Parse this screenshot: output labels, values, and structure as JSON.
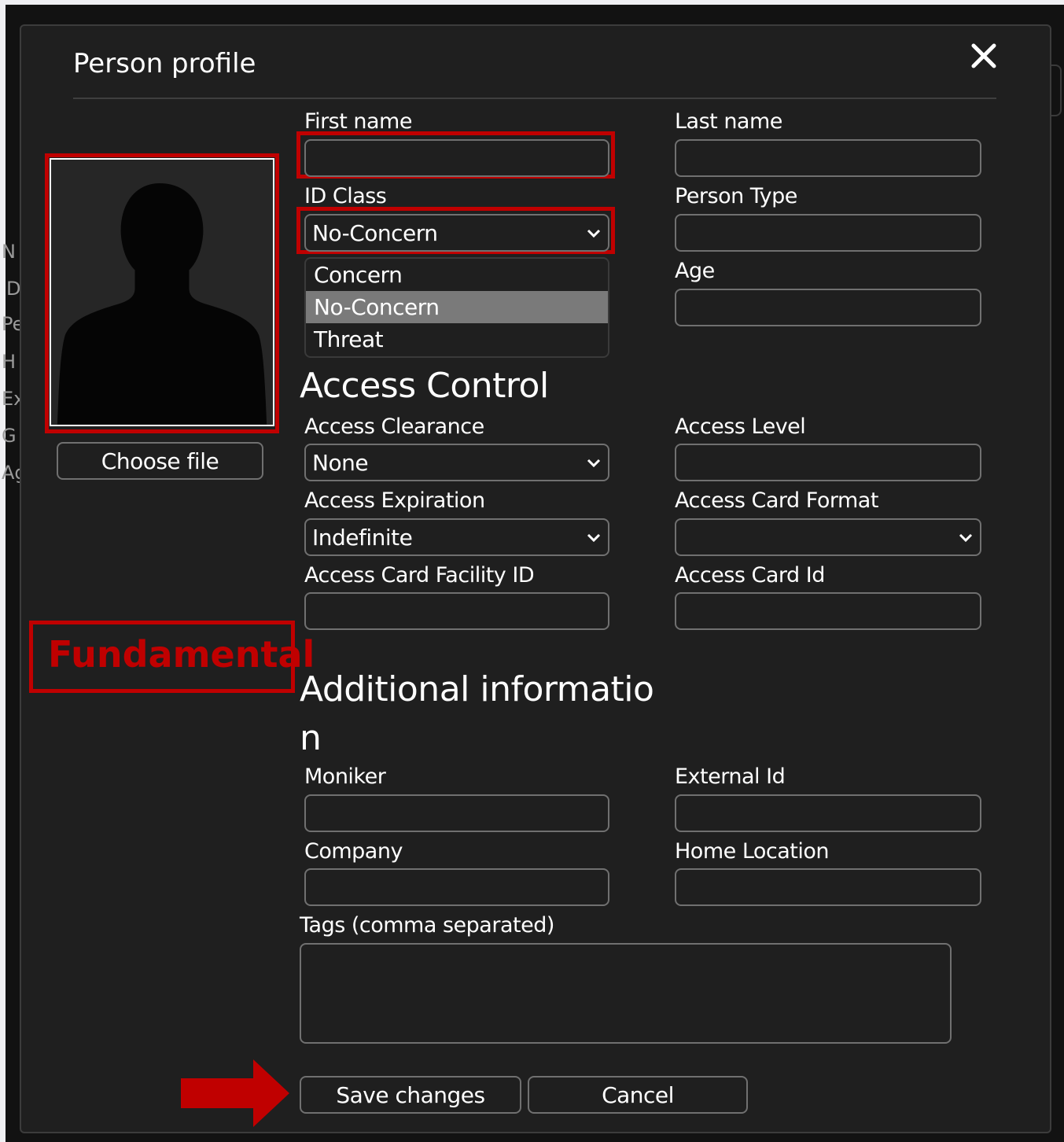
{
  "background": {
    "clipped_labels": [
      "N",
      "D",
      "Pe",
      "H",
      "Ex",
      "G",
      "Ag"
    ]
  },
  "modal": {
    "title": "Person profile",
    "close_icon": "close-icon"
  },
  "photo": {
    "placeholder_icon": "person-silhouette-icon",
    "choose_file_label": "Choose file"
  },
  "annotations": {
    "fundamental_label": "Fundamental",
    "highlight_color": "#c00000",
    "arrow_icon": "arrow-right-icon"
  },
  "fundamental": {
    "first_name": {
      "label": "First name",
      "value": ""
    },
    "last_name": {
      "label": "Last name",
      "value": ""
    },
    "id_class": {
      "label": "ID Class",
      "selected": "No-Concern",
      "options": [
        "Concern",
        "No-Concern",
        "Threat"
      ],
      "open": true
    },
    "person_type": {
      "label": "Person Type",
      "value": ""
    },
    "age": {
      "label": "Age",
      "value": ""
    }
  },
  "access_control": {
    "heading": "Access Control",
    "access_clearance": {
      "label": "Access Clearance",
      "selected": "None"
    },
    "access_level": {
      "label": "Access Level",
      "value": ""
    },
    "access_expiration": {
      "label": "Access Expiration",
      "selected": "Indefinite"
    },
    "access_card_format": {
      "label": "Access Card Format",
      "selected": ""
    },
    "access_card_facility_id": {
      "label": "Access Card Facility ID",
      "value": ""
    },
    "access_card_id": {
      "label": "Access Card Id",
      "value": ""
    }
  },
  "additional": {
    "heading_line1": "Additional informatio",
    "heading_line2": "n",
    "moniker": {
      "label": "Moniker",
      "value": ""
    },
    "external_id": {
      "label": "External Id",
      "value": ""
    },
    "company": {
      "label": "Company",
      "value": ""
    },
    "home_location": {
      "label": "Home Location",
      "value": ""
    },
    "tags": {
      "label": "Tags (comma separated)",
      "value": ""
    }
  },
  "footer": {
    "save_label": "Save changes",
    "cancel_label": "Cancel"
  }
}
